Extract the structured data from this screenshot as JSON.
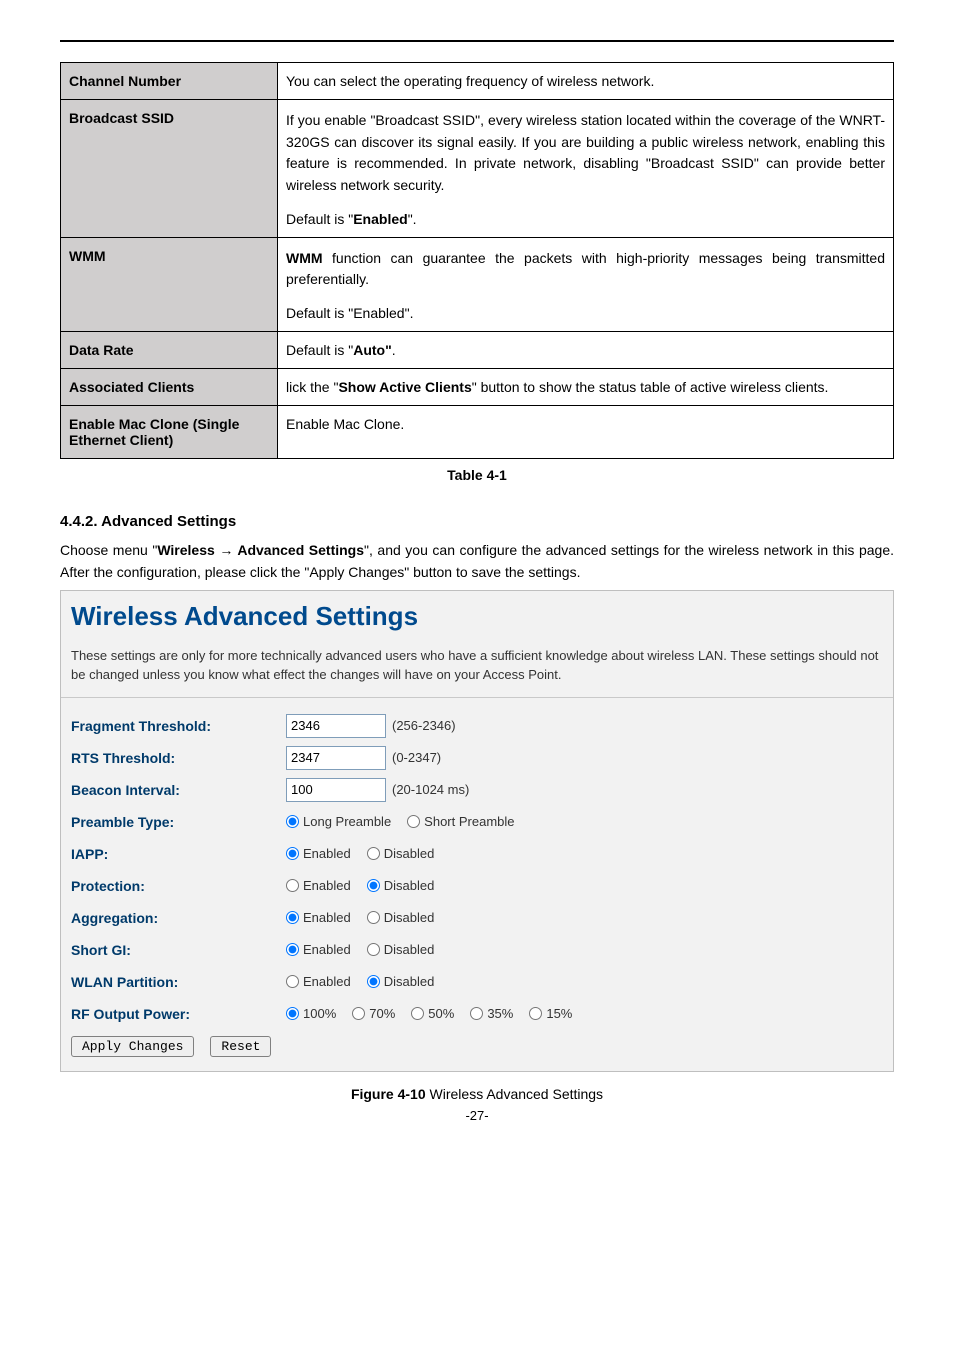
{
  "table": {
    "rows": [
      {
        "label": "Channel Number",
        "desc_plain": "You can select the operating frequency of wireless network."
      },
      {
        "label": "Broadcast SSID",
        "desc_html": "If you enable \"Broadcast SSID\", every wireless station located within the coverage of the WNRT-320GS can discover its signal easily. If you are building a public wireless network, enabling this feature is recommended. In private network, disabling \"Broadcast SSID\" can provide better wireless network security.",
        "desc_tail_pre": "Default is \"",
        "desc_tail_bold": "Enabled",
        "desc_tail_post": "\"."
      },
      {
        "label": "WMM",
        "desc_html_pre": "",
        "desc_html_bold": "WMM",
        "desc_html_post": " function can guarantee the packets with high-priority messages being transmitted preferentially.",
        "desc_tail": "Default is \"Enabled\"."
      },
      {
        "label": "Data Rate",
        "desc_pre": "Default is \"",
        "desc_bold": "Auto\"",
        "desc_post": "."
      },
      {
        "label": "Associated Clients",
        "desc_pre": " lick the \"",
        "desc_bold": "Show Active Clients",
        "desc_post": "\" button to show the status table of active wireless clients."
      },
      {
        "label": "Enable Mac Clone (Single Ethernet Client)",
        "desc_plain": "Enable Mac Clone."
      }
    ],
    "caption": "Table 4-1"
  },
  "section": {
    "heading": "4.4.2.  Advanced Settings",
    "body_pre": "Choose menu \"",
    "body_bold1": "Wireless → Advanced Settings",
    "body_post": "\", and you can configure the advanced settings for the wireless network in this page. After the configuration, please click the \"Apply Changes\" button to save the settings."
  },
  "panel": {
    "title": "Wireless Advanced Settings",
    "desc": "These settings are only for more technically advanced users who have a sufficient knowledge about wireless LAN. These settings should not be changed unless you know what effect the changes will have on your Access Point.",
    "rows": {
      "fragment": {
        "label": "Fragment Threshold:",
        "value": "2346",
        "hint": "(256-2346)"
      },
      "rts": {
        "label": "RTS Threshold:",
        "value": "2347",
        "hint": "(0-2347)"
      },
      "beacon": {
        "label": "Beacon Interval:",
        "value": "100",
        "hint": "(20-1024 ms)"
      },
      "preamble": {
        "label": "Preamble Type:",
        "opt1": "Long Preamble",
        "opt2": "Short Preamble"
      },
      "iapp": {
        "label": "IAPP:",
        "opt1": "Enabled",
        "opt2": "Disabled"
      },
      "protection": {
        "label": "Protection:",
        "opt1": "Enabled",
        "opt2": "Disabled"
      },
      "aggregation": {
        "label": "Aggregation:",
        "opt1": "Enabled",
        "opt2": "Disabled"
      },
      "shortgi": {
        "label": "Short GI:",
        "opt1": "Enabled",
        "opt2": "Disabled"
      },
      "wlanpart": {
        "label": "WLAN Partition:",
        "opt1": "Enabled",
        "opt2": "Disabled"
      },
      "rfpower": {
        "label": "RF Output Power:",
        "opts": [
          "100%",
          "70%",
          "50%",
          "35%",
          "15%"
        ]
      }
    },
    "buttons": {
      "apply": "Apply Changes",
      "reset": "Reset"
    }
  },
  "figure": {
    "bold": "Figure 4-10",
    "rest": " Wireless Advanced Settings"
  },
  "footer": "-27-"
}
